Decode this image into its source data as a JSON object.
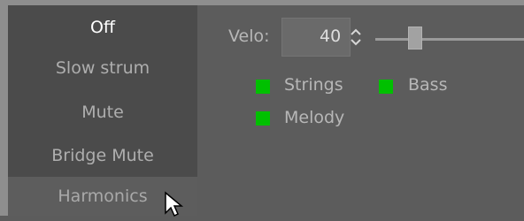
{
  "menu": {
    "items": [
      {
        "label": "Off",
        "state": "selected"
      },
      {
        "label": "Slow strum",
        "state": "normal"
      },
      {
        "label": "Mute",
        "state": "normal"
      },
      {
        "label": "Bridge Mute",
        "state": "normal"
      },
      {
        "label": "Harmonics",
        "state": "hover"
      }
    ]
  },
  "velo": {
    "label": "Velo:",
    "value": "40",
    "slider_fraction": 0.27
  },
  "checks": {
    "strings": {
      "label": "Strings",
      "checked": true
    },
    "bass": {
      "label": "Bass",
      "checked": true
    },
    "melody": {
      "label": "Melody",
      "checked": true
    }
  },
  "colors": {
    "background": "#5c5c5c",
    "menu_bg": "#4b4b4b",
    "check_green": "#00c000",
    "text": "#b7b7b7"
  },
  "icons": {
    "spin": "spin-up-down-icon",
    "cursor": "mouse-pointer-icon"
  }
}
